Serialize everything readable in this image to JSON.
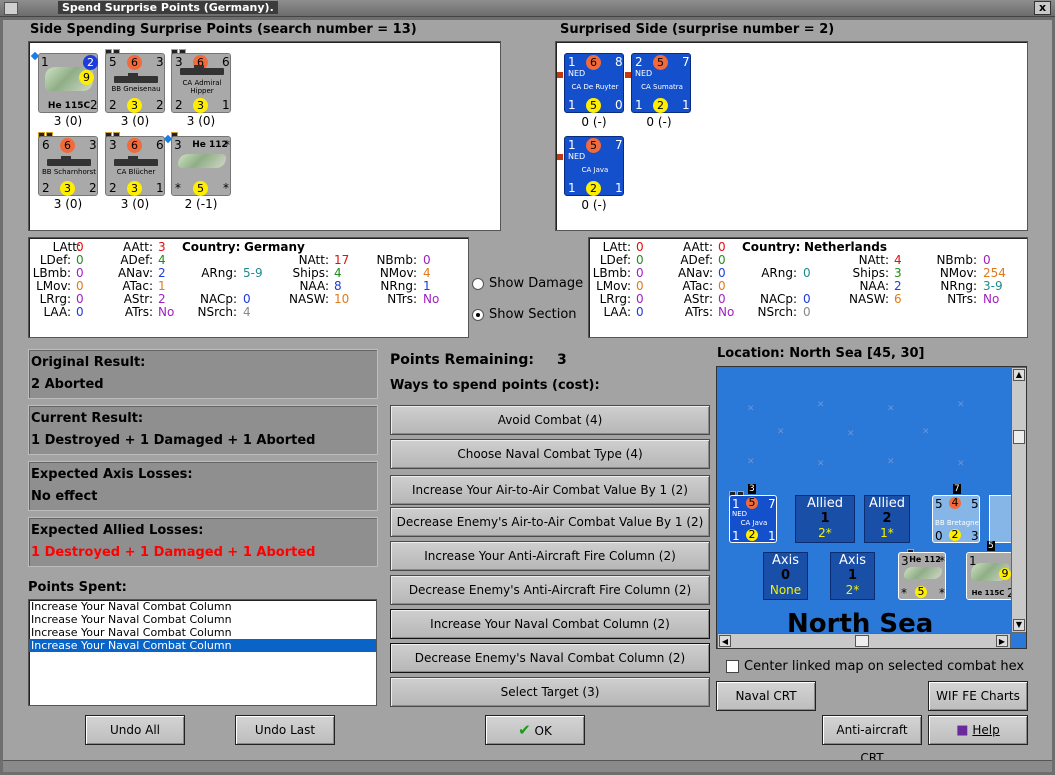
{
  "window": {
    "title": "Spend Surprise Points (Germany).",
    "close_label": "x"
  },
  "attacker": {
    "header": "Side Spending Surprise Points (search number = 13)",
    "units": [
      {
        "name": "He 115C",
        "tl": "1",
        "tc": "",
        "tr": "",
        "blue_circle": "2",
        "yellow_mid": "9",
        "bl": "",
        "bc": "",
        "br": "2",
        "points": "3 (0)",
        "kind": "plane"
      },
      {
        "name": "BB Gneisenau",
        "tl": "5",
        "tc": "6",
        "tr": "3",
        "bl": "2",
        "bc": "3",
        "br": "2",
        "points": "3 (0)",
        "kind": "ship"
      },
      {
        "name": "CA Admiral Hipper",
        "tl": "3",
        "tc": "6",
        "tr": "6",
        "bl": "2",
        "bc": "3",
        "br": "1",
        "points": "3 (0)",
        "kind": "ship"
      },
      {
        "name": "BB Scharnhorst",
        "tl": "6",
        "tc": "6",
        "tr": "3",
        "bl": "2",
        "bc": "3",
        "br": "2",
        "points": "3 (0)",
        "kind": "ship"
      },
      {
        "name": "CA Blücher",
        "tl": "3",
        "tc": "6",
        "tr": "6",
        "bl": "2",
        "bc": "3",
        "br": "1",
        "points": "3 (0)",
        "kind": "ship"
      },
      {
        "name": "He 112",
        "tl": "3",
        "tc": "",
        "tr": "*",
        "bl": "*",
        "bc": "5",
        "br": "*",
        "points": "2 (-1)",
        "kind": "plane2"
      }
    ]
  },
  "defender": {
    "header": "Surprised Side (surprise number = 2)",
    "units": [
      {
        "name": "CA De Ruyter",
        "tag": "NED",
        "tl": "1",
        "tc": "6",
        "tr": "8",
        "bl": "1",
        "bc": "5",
        "br": "0",
        "points": "0 (-)"
      },
      {
        "name": "CA Sumatra",
        "tag": "NED",
        "tl": "2",
        "tc": "5",
        "tr": "7",
        "bl": "1",
        "bc": "2",
        "br": "1",
        "points": "0 (-)"
      },
      {
        "name": "CA Java",
        "tag": "NED",
        "tl": "1",
        "tc": "5",
        "tr": "7",
        "bl": "1",
        "bc": "2",
        "br": "1",
        "points": "0 (-)"
      }
    ]
  },
  "stats_left": {
    "country_label": "Country:",
    "country": "Germany",
    "LAtt": "0",
    "LDef": "0",
    "LBmb": "0",
    "LMov": "0",
    "LRrg": "0",
    "LAA": "0",
    "AAtt": "3",
    "ADef": "4",
    "ANav": "2",
    "ATac": "1",
    "AStr": "2",
    "ATrs": "No",
    "ARng": "5-9",
    "NACp": "0",
    "NSrch": "4",
    "NAtt": "17",
    "Ships": "4",
    "NAA": "8",
    "NASW": "10",
    "NBmb": "0",
    "NMov": "4",
    "NRng": "1",
    "NTrs": "No"
  },
  "stats_right": {
    "country_label": "Country:",
    "country": "Netherlands",
    "LAtt": "0",
    "LDef": "0",
    "LBmb": "0",
    "LMov": "0",
    "LRrg": "0",
    "LAA": "0",
    "AAtt": "0",
    "ADef": "0",
    "ANav": "0",
    "ATac": "0",
    "AStr": "0",
    "ATrs": "No",
    "ARng": "0",
    "NACp": "0",
    "NSrch": "0",
    "NAtt": "4",
    "Ships": "3",
    "NAA": "2",
    "NASW": "6",
    "NBmb": "0",
    "NMov": "254",
    "NRng": "3-9",
    "NTrs": "No"
  },
  "toggles": {
    "show_damage": "Show Damage",
    "show_section": "Show Section",
    "selected": "show_section"
  },
  "results": {
    "original_title": "Original Result:",
    "original_value": "2 Aborted",
    "current_title": "Current Result:",
    "current_value": "1 Destroyed + 1 Damaged + 1 Aborted",
    "axis_title": "Expected Axis Losses:",
    "axis_value": "No effect",
    "allied_title": "Expected Allied Losses:",
    "allied_value": "1 Destroyed + 1 Damaged + 1 Aborted"
  },
  "points": {
    "remaining_label": "Points Remaining:",
    "remaining": "3",
    "ways_label": "Ways to spend points (cost):",
    "spent_label": "Points Spent:",
    "spent": [
      "Increase Your Naval Combat Column",
      "Increase Your Naval Combat Column",
      "Increase Your Naval Combat Column",
      "Increase Your Naval Combat Column"
    ],
    "selected_index": 3
  },
  "options": [
    "Avoid Combat (4)",
    "Choose Naval Combat Type (4)",
    "Increase Your Air-to-Air Combat Value By 1 (2)",
    "Decrease Enemy's Air-to-Air Combat Value By 1 (2)",
    "Increase Your Anti-Aircraft Fire Column (2)",
    "Decrease Enemy's Anti-Aircraft Fire Column (2)",
    "Increase Your Naval Combat Column (2)",
    "Decrease Enemy's Naval Combat Column (2)",
    "Select Target (3)"
  ],
  "map": {
    "location": "Location: North Sea [45, 30]",
    "sea_name": "North Sea",
    "allied_boxes": [
      {
        "type": "Allied",
        "count": "1",
        "extra": "2*"
      },
      {
        "type": "Allied",
        "count": "2",
        "extra": "1*"
      }
    ],
    "axis_boxes": [
      {
        "type": "Axis",
        "count": "0",
        "extra": "None"
      },
      {
        "type": "Axis",
        "count": "1",
        "extra": "2*"
      }
    ],
    "stack_labels": {
      "java_stack": "3",
      "bretagne_stack": "7",
      "he115_stack": "5"
    },
    "map_units": [
      {
        "name": "CA Java",
        "tag": "NED",
        "tl": "1",
        "tc": "5",
        "tr": "7",
        "bl": "1",
        "bc": "2",
        "br": "1"
      },
      {
        "name": "BB Bretagne",
        "tl": "5",
        "tc": "4",
        "tr": "5",
        "bl": "0",
        "bc": "2",
        "br": "3"
      },
      {
        "name": "He 112",
        "tl": "3",
        "tc": "",
        "tr": "*",
        "bl": "*",
        "bc": "5",
        "br": "*"
      },
      {
        "name": "He 115C",
        "tl": "1",
        "tc": "",
        "tr": "",
        "bl": "",
        "bc": "9",
        "br": "2"
      }
    ],
    "center_checkbox": "Center linked map on selected combat hex"
  },
  "buttons": {
    "undo_all": "Undo All",
    "undo_last": "Undo Last",
    "ok": "OK",
    "naval_crt": "Naval CRT",
    "wif_charts": "WIF FE Charts",
    "aa_crt": "Anti-aircraft CRT",
    "help": "Help"
  },
  "colors": {
    "accent_red": "#ff0000",
    "orange": "#e07a1a",
    "green": "#1e8c1e",
    "blue": "#1e3cd8",
    "purple": "#a020c0",
    "sea": "#2a78d8"
  }
}
